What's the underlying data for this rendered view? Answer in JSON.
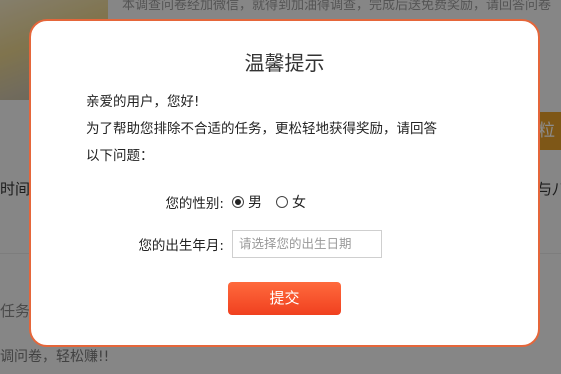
{
  "background": {
    "top_line": "本调查问卷经加微信，就得到加油得调查，完成后送免费奖励，请回答问卷",
    "chip": "粒",
    "left_label_1": "时间:",
    "right_label_1": "与八",
    "left_label_2": "任务",
    "left_label_3": "调问卷，轻松赚!!"
  },
  "dialog": {
    "title": "温馨提示",
    "greeting": "亲爱的用户，您好!",
    "message_line_1": "为了帮助您排除不合适的任务，更松轻地获得奖励，请回答",
    "message_line_2": "以下问题：",
    "gender_label": "您的性别:",
    "gender_options": [
      {
        "label": "男",
        "selected": true
      },
      {
        "label": "女",
        "selected": false
      }
    ],
    "birth_label": "您的出生年月:",
    "birth_placeholder": "请选择您的出生日期",
    "submit_label": "提交"
  },
  "colors": {
    "accent": "#f0401f",
    "border": "#e5663a"
  }
}
